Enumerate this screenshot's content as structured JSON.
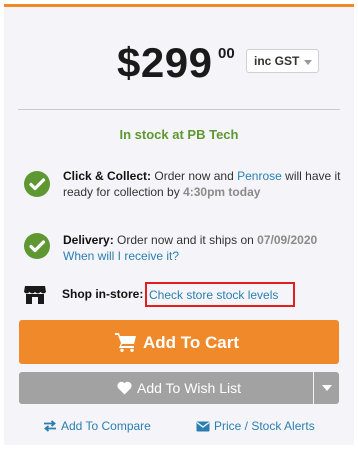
{
  "price": {
    "dollars": "$299",
    "cents": "00",
    "tax_option": "inc GST"
  },
  "stock_status": "In stock at PB Tech",
  "click_collect": {
    "label": "Click & Collect:",
    "text_before_store": "Order now and",
    "store": "Penrose",
    "text_after_store": "will have it ready for collection by",
    "time": "4:30pm today"
  },
  "delivery": {
    "label": "Delivery:",
    "text": "Order now and it ships on",
    "date": "07/09/2020",
    "link": "When will I receive it?"
  },
  "in_store": {
    "label": "Shop in-store:",
    "link": "Check store stock levels"
  },
  "buttons": {
    "add_to_cart": "Add To Cart",
    "add_to_wish_list": "Add To Wish List",
    "add_to_compare": "Add To Compare",
    "price_stock_alerts": "Price / Stock Alerts"
  },
  "colors": {
    "accent_orange": "#f0892a",
    "success_green": "#5f9732",
    "link_blue": "#2a7fb0",
    "highlight_red": "#e21e1e",
    "button_grey": "#a2a2a2"
  },
  "icons": [
    "check-circle-icon",
    "store-icon",
    "cart-icon",
    "heart-icon",
    "caret-down-icon",
    "exchange-arrows-icon",
    "envelope-icon"
  ]
}
